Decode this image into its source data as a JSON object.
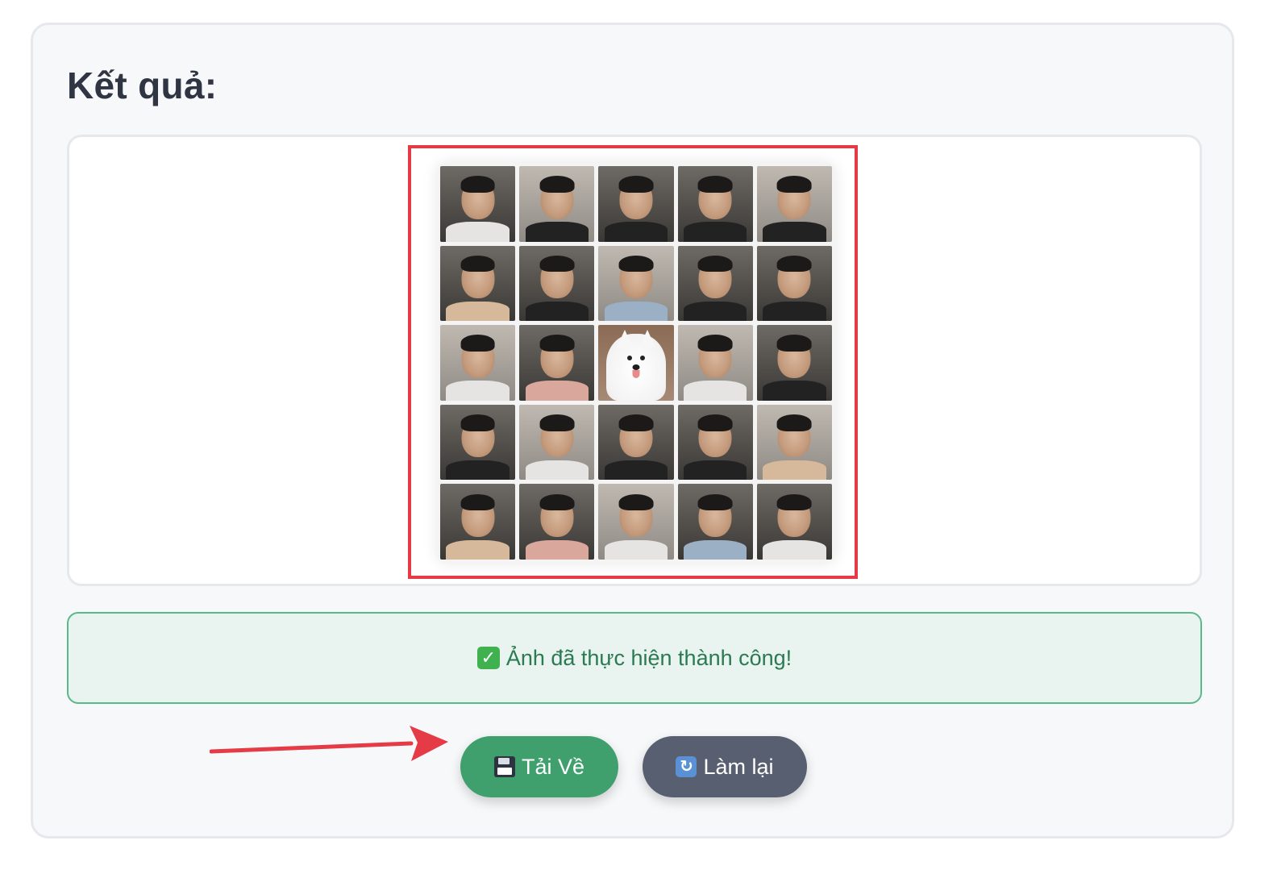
{
  "section": {
    "title": "Kết quả:"
  },
  "status": {
    "icon": "check-mark-icon",
    "text": "Ảnh đã thực hiện thành công!"
  },
  "buttons": {
    "download": {
      "icon": "floppy-disk-icon",
      "label": "Tải Về"
    },
    "reset": {
      "icon": "refresh-icon",
      "label": "Làm lại"
    }
  },
  "image_grid": {
    "rows": 5,
    "cols": 5,
    "tiles": [
      "light",
      "bg-dark",
      "dark",
      "dark",
      "dark",
      "tan",
      "dark",
      "blue",
      "dark",
      "dark",
      "light",
      "pink",
      "dog",
      "light",
      "dark",
      "dark",
      "light",
      "dark",
      "dark",
      "tan",
      "tan",
      "pink",
      "light",
      "blue",
      "light"
    ]
  },
  "colors": {
    "accent_green": "#3fa06e",
    "reset_gray": "#585f70",
    "highlight_red": "#e53b46",
    "status_bg": "#e9f3ef",
    "status_text": "#2a7a52"
  }
}
